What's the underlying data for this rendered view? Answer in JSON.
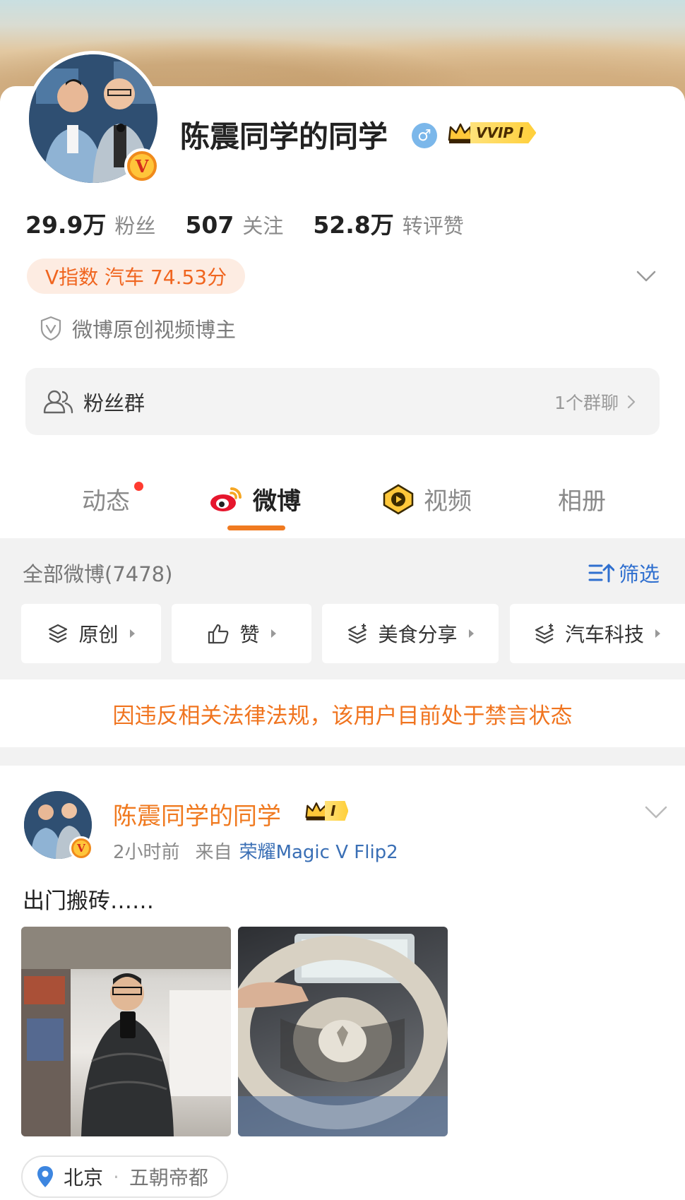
{
  "profile": {
    "name": "陈震同学的同学",
    "gender_symbol": "♂",
    "vip_label": "VVIP I",
    "verified_badge": "V",
    "stats": [
      {
        "value": "29.9万",
        "label": "粉丝"
      },
      {
        "value": "507",
        "label": "关注"
      },
      {
        "value": "52.8万",
        "label": "转评赞"
      }
    ],
    "v_index": "V指数 汽车 74.53分",
    "certification": "微博原创视频博主",
    "fans_group": {
      "label": "粉丝群",
      "count": "1个群聊"
    }
  },
  "tabs": [
    {
      "label": "动态",
      "has_dot": true
    },
    {
      "label": "微博",
      "active": true
    },
    {
      "label": "视频"
    },
    {
      "label": "相册"
    }
  ],
  "feed_header": {
    "all_weibo": "全部微博(7478)",
    "filter_label": "筛选",
    "chips": [
      "原创",
      "赞",
      "美食分享",
      "汽车科技"
    ]
  },
  "ban_notice": "因违反相关法律法规，该用户目前处于禁言状态",
  "post": {
    "author": "陈震同学的同学",
    "vip_label": "I",
    "time": "2小时前",
    "from_label": "来自",
    "source": "荣耀Magic V Flip2",
    "text": "出门搬砖……",
    "location": {
      "city": "北京",
      "place": "五朝帝都"
    }
  },
  "colors": {
    "accent": "#f07a20",
    "link": "#2f6fcf",
    "danger_dot": "#ff3b30"
  }
}
